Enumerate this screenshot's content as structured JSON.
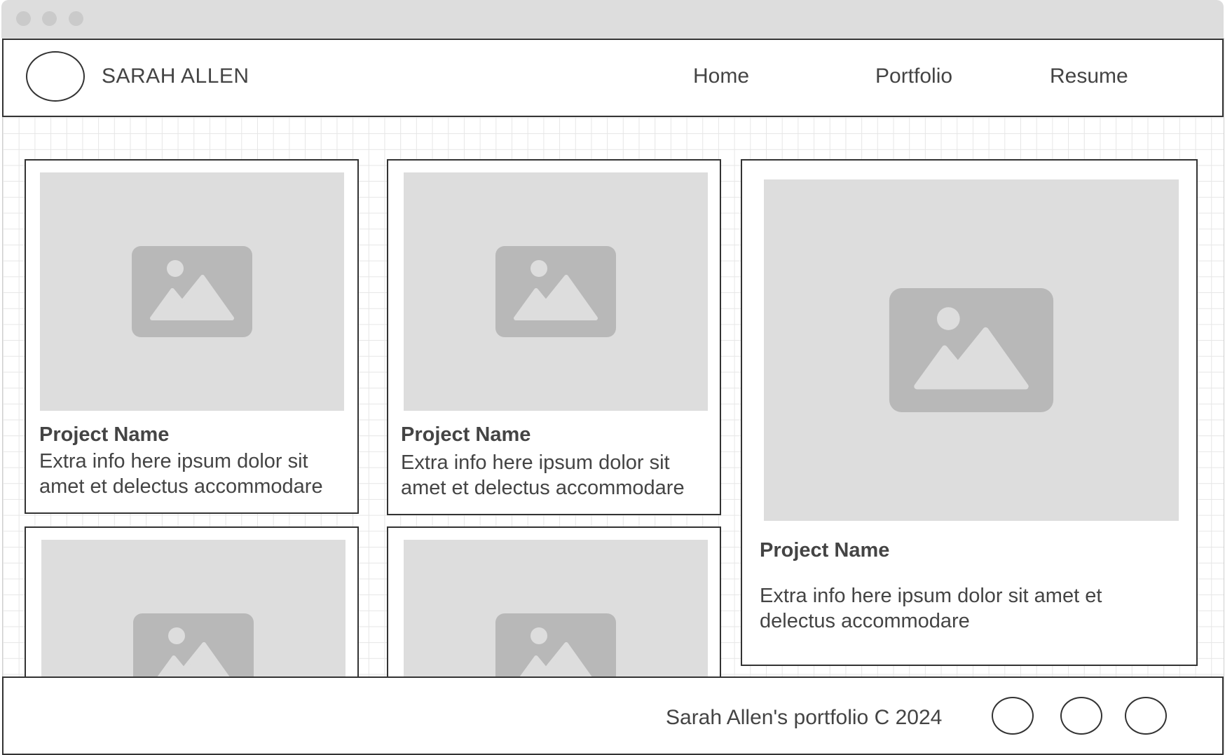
{
  "header": {
    "brand": "SARAH ALLEN",
    "nav": [
      "Home",
      "Portfolio",
      "Resume"
    ]
  },
  "projects": [
    {
      "name": "Project Name",
      "description": "Extra info here ipsum dolor sit amet et delectus accommodare"
    },
    {
      "name": "Project Name",
      "description": "Extra info here ipsum dolor sit amet et delectus accommodare"
    },
    {
      "name": "Project Name",
      "description": "Extra info here ipsum dolor sit amet et delectus accommodare"
    }
  ],
  "footer": {
    "copyright": "Sarah Allen's portfolio C 2024",
    "social_icons": [
      "social-icon",
      "social-icon",
      "social-icon"
    ]
  },
  "colors": {
    "border": "#333333",
    "placeholder_bg": "#dddddd",
    "placeholder_icon": "#b8b8b8",
    "text": "#444444",
    "titlebar": "#dddddd"
  }
}
